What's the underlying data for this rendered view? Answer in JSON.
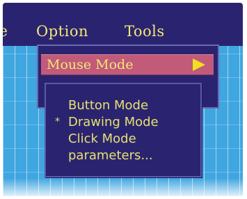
{
  "menubar": {
    "edge_item": "e",
    "menus": [
      {
        "label": "Option"
      },
      {
        "label": "Tools"
      }
    ]
  },
  "dropdown": {
    "items": [
      {
        "label": "Mouse Mode",
        "has_submenu": true,
        "highlighted": true
      }
    ]
  },
  "submenu": {
    "checkmark": "*",
    "items": [
      {
        "label": "Button Mode",
        "checked": false
      },
      {
        "label": "Drawing Mode",
        "checked": true
      },
      {
        "label": "Click Mode",
        "checked": false
      },
      {
        "label": "parameters...",
        "checked": false
      }
    ]
  },
  "colors": {
    "menu_bg": "#2a2470",
    "menu_text": "#f0e878",
    "highlight_bg": "#c25a7a",
    "arrow": "#f0e020",
    "canvas_bg": "#3fa6e0"
  }
}
